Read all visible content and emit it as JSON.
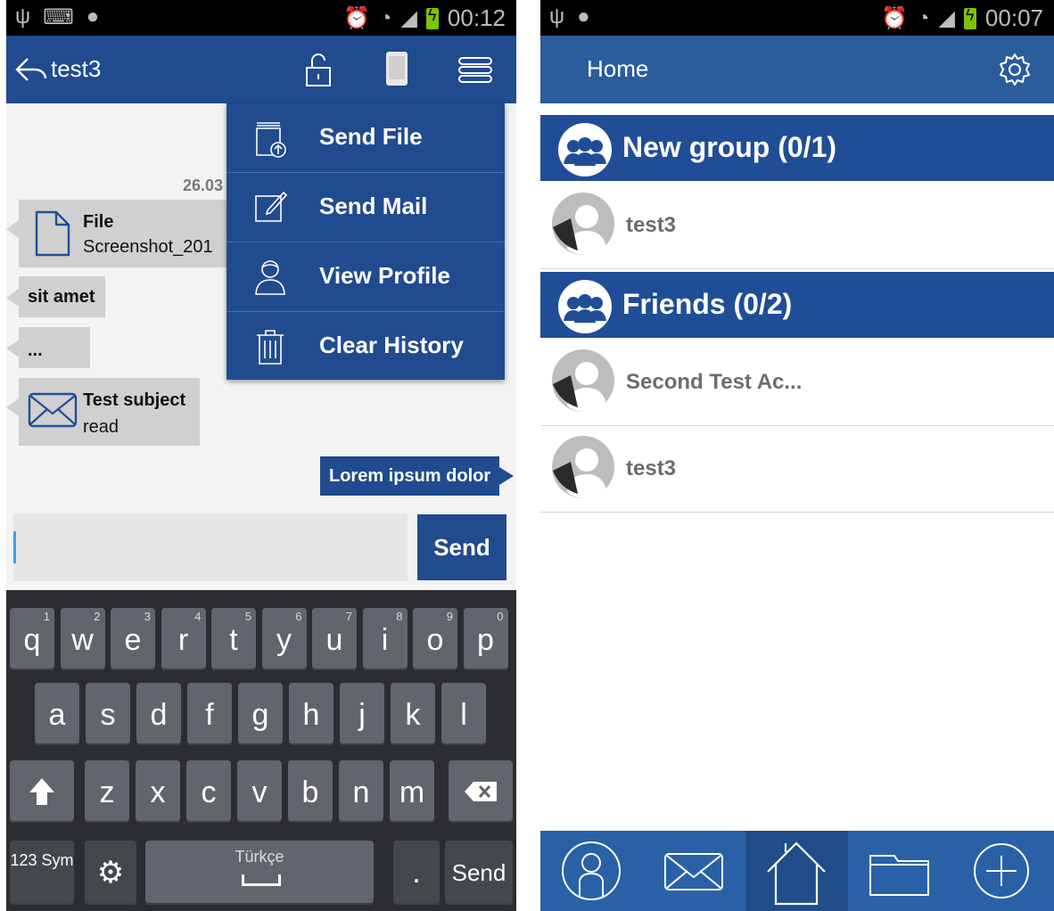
{
  "left": {
    "status": {
      "time": "00:12"
    },
    "header": {
      "title": "test3"
    },
    "menu": {
      "items": [
        {
          "label": "Send File",
          "icon": "upload-file-icon"
        },
        {
          "label": "Send Mail",
          "icon": "compose-icon"
        },
        {
          "label": "View Profile",
          "icon": "profile-icon"
        },
        {
          "label": "Clear History",
          "icon": "trash-icon"
        }
      ]
    },
    "chat": {
      "date": "26.03",
      "messages": [
        {
          "title": "File",
          "subtitle": "Screenshot_201"
        },
        {
          "text": "sit amet"
        },
        {
          "text": "..."
        },
        {
          "title": "Test subject",
          "subtitle": "read"
        }
      ],
      "outgoing": "Lorem ipsum dolor",
      "input_value": "",
      "send_label": "Send"
    },
    "keyboard": {
      "row1": [
        {
          "k": "q",
          "n": "1"
        },
        {
          "k": "w",
          "n": "2"
        },
        {
          "k": "e",
          "n": "3"
        },
        {
          "k": "r",
          "n": "4"
        },
        {
          "k": "t",
          "n": "5"
        },
        {
          "k": "y",
          "n": "6"
        },
        {
          "k": "u",
          "n": "7"
        },
        {
          "k": "i",
          "n": "8"
        },
        {
          "k": "o",
          "n": "9"
        },
        {
          "k": "p",
          "n": "0"
        }
      ],
      "row2": [
        "a",
        "s",
        "d",
        "f",
        "g",
        "h",
        "j",
        "k",
        "l"
      ],
      "row3": [
        "z",
        "x",
        "c",
        "v",
        "b",
        "n",
        "m"
      ],
      "sym_label": "123 Sym",
      "space_label": "Türkçe",
      "period_label": ".",
      "send_label": "Send"
    }
  },
  "right": {
    "status": {
      "time": "00:07"
    },
    "header": {
      "title": "Home"
    },
    "groups": [
      {
        "label": "New group (0/1)",
        "contacts": [
          "test3"
        ]
      },
      {
        "label": "Friends (0/2)",
        "contacts": [
          "Second Test Ac...",
          "test3"
        ]
      }
    ],
    "nav": [
      "contacts-icon",
      "mail-icon",
      "home-icon",
      "folder-icon",
      "add-icon"
    ]
  },
  "colors": {
    "primary": "#214b8f",
    "group_header": "#1f4e96",
    "bubble": "#d0d0d0"
  }
}
